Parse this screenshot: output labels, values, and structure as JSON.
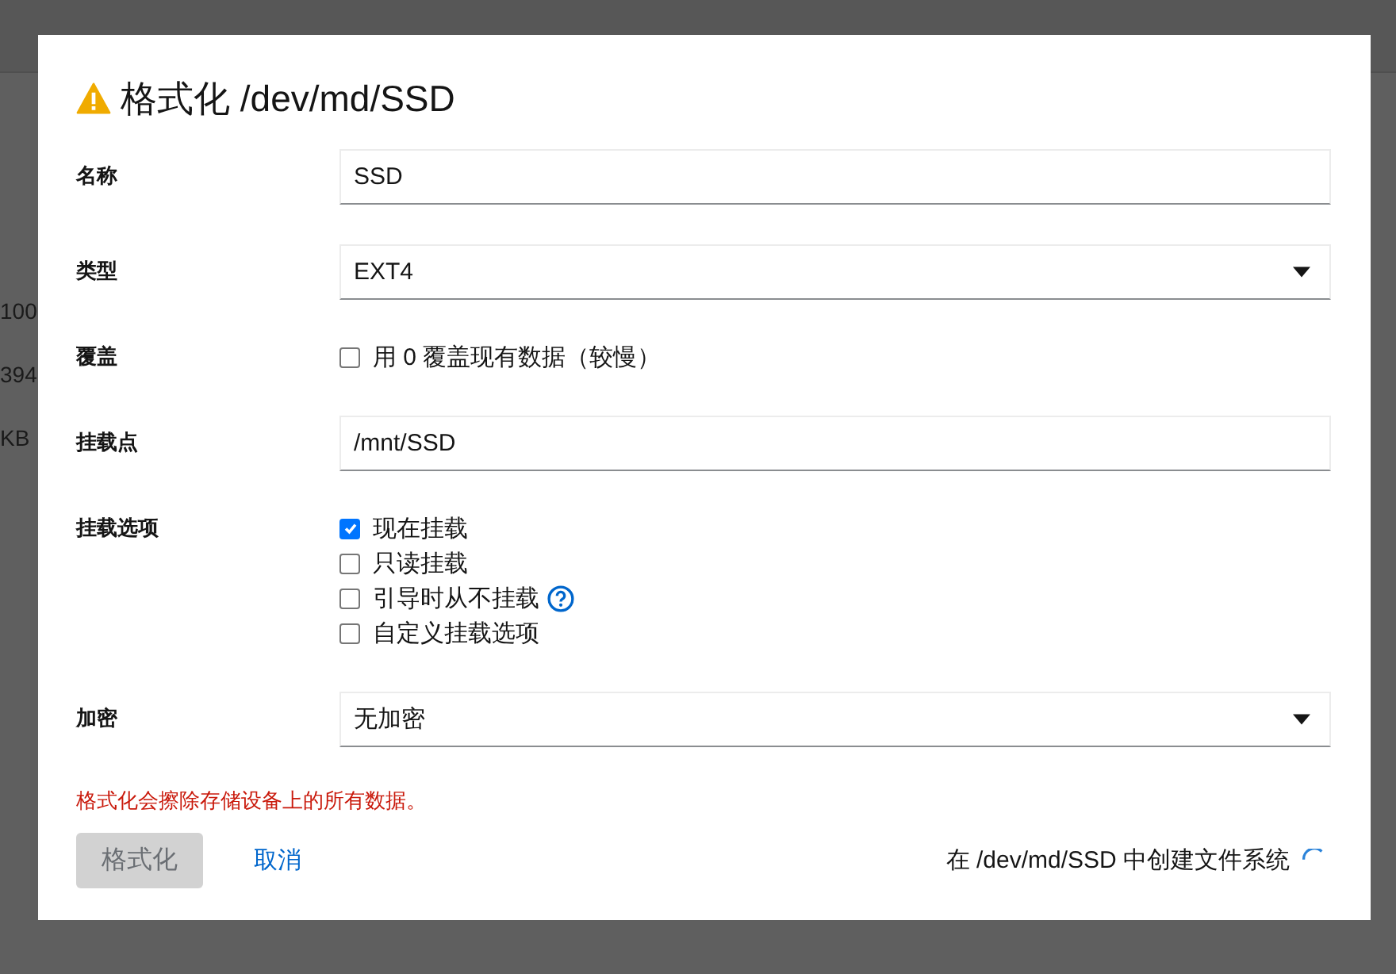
{
  "background": {
    "left_fragments": [
      "100",
      "394",
      "KB"
    ]
  },
  "dialog": {
    "title": "格式化 /dev/md/SSD",
    "fields": [
      {
        "kind": "text",
        "label": "名称",
        "value": "SSD"
      },
      {
        "kind": "select",
        "label": "类型",
        "value": "EXT4"
      },
      {
        "kind": "checks",
        "label": "覆盖",
        "options": [
          {
            "label": "用 0 覆盖现有数据（较慢）",
            "checked": false
          }
        ]
      },
      {
        "kind": "text",
        "label": "挂载点",
        "value": "/mnt/SSD"
      },
      {
        "kind": "checks",
        "label": "挂载选项",
        "options": [
          {
            "label": "现在挂载",
            "checked": true
          },
          {
            "label": "只读挂载",
            "checked": false
          },
          {
            "label": "引导时从不挂载",
            "checked": false,
            "help": true
          },
          {
            "label": "自定义挂载选项",
            "checked": false
          }
        ]
      },
      {
        "kind": "select",
        "label": "加密",
        "value": "无加密"
      }
    ],
    "warning": "格式化会擦除存储设备上的所有数据。",
    "primary_button": {
      "label": "格式化",
      "disabled": true
    },
    "cancel_link": "取消",
    "status": "在 /dev/md/SSD 中创建文件系统"
  }
}
